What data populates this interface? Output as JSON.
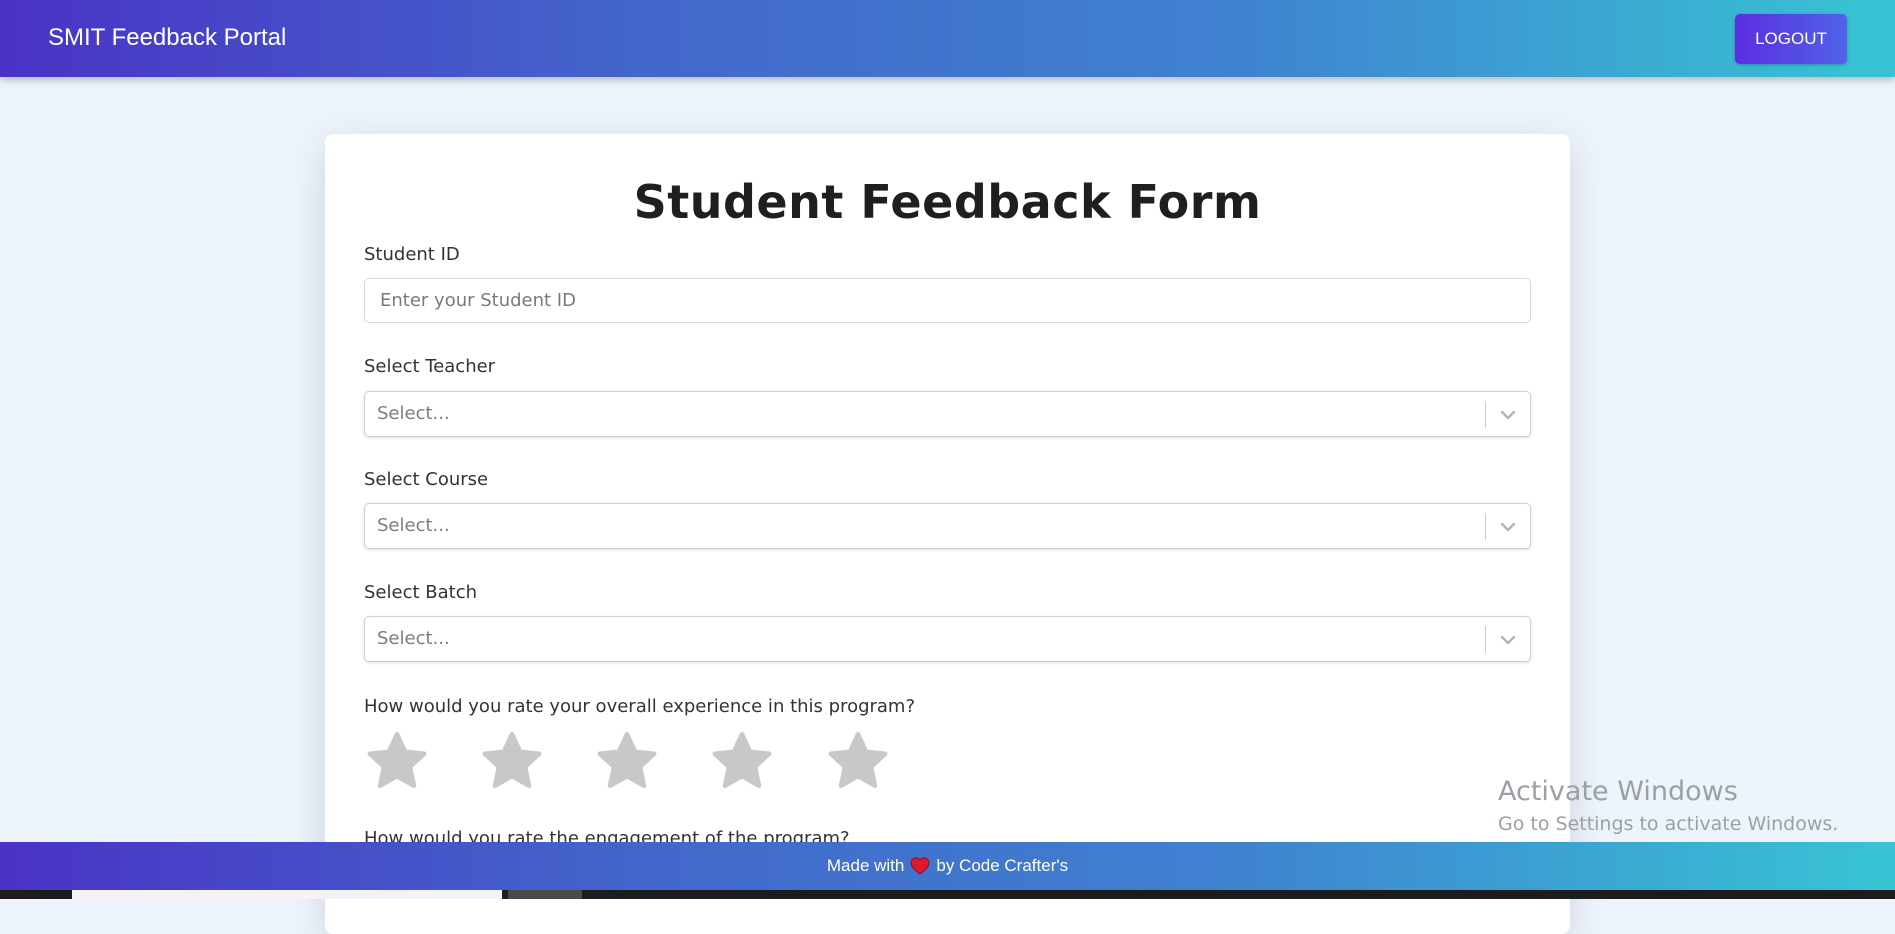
{
  "header": {
    "brand": "SMIT Feedback Portal",
    "logout_label": "LOGOUT"
  },
  "form": {
    "title": "Student Feedback Form",
    "student_id": {
      "label": "Student ID",
      "placeholder": "Enter your Student ID"
    },
    "teacher": {
      "label": "Select Teacher",
      "placeholder": "Select..."
    },
    "course": {
      "label": "Select Course",
      "placeholder": "Select..."
    },
    "batch": {
      "label": "Select Batch",
      "placeholder": "Select..."
    },
    "q1": {
      "text": "How would you rate your overall experience in this program?",
      "rating": 0,
      "max_rating": 5
    },
    "q2": {
      "text": "How would you rate the engagement of the program?"
    }
  },
  "footer": {
    "prefix": "Made with",
    "suffix": "by Code Crafter's"
  },
  "watermark": {
    "line1": "Activate Windows",
    "line2": "Go to Settings to activate Windows."
  },
  "colors": {
    "brand_gradient_start": "#4a33c6",
    "brand_gradient_end": "#38c4d4",
    "star_empty": "#c8c8c8",
    "heart": "#e0182d"
  },
  "icons": {
    "rating": "star-icon",
    "dropdown": "chevron-down-icon",
    "footer": "heart-icon"
  }
}
